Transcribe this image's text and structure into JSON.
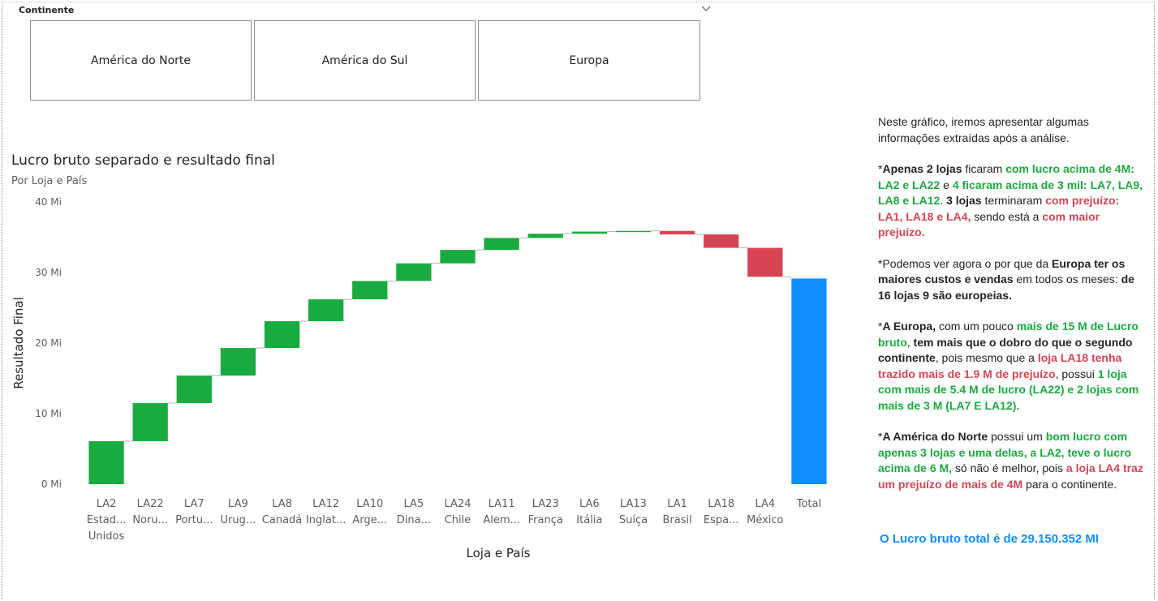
{
  "slicer": {
    "header": "Continente",
    "options": [
      "América do Norte",
      "América do Sul",
      "Europa"
    ]
  },
  "chart": {
    "title": "Lucro bruto separado e resultado final",
    "subtitle": "Por Loja e País"
  },
  "chart_data": {
    "type": "waterfall",
    "title": "Lucro bruto separado e resultado final",
    "subtitle": "Por Loja e País",
    "xlabel": "Loja e País",
    "ylabel": "Resultado Final",
    "ylim": [
      0,
      40
    ],
    "y_unit": "Mi",
    "yticks": [
      "0 Mi",
      "10 Mi",
      "20 Mi",
      "30 Mi",
      "40 Mi"
    ],
    "categories": [
      {
        "store": "LA2",
        "country": "Estad... Unidos",
        "value": 6.1
      },
      {
        "store": "LA22",
        "country": "Noru...",
        "value": 5.4
      },
      {
        "store": "LA7",
        "country": "Portu...",
        "value": 3.9
      },
      {
        "store": "LA9",
        "country": "Urug...",
        "value": 3.9
      },
      {
        "store": "LA8",
        "country": "Canadá",
        "value": 3.8
      },
      {
        "store": "LA12",
        "country": "Inglat...",
        "value": 3.1
      },
      {
        "store": "LA10",
        "country": "Arge...",
        "value": 2.6
      },
      {
        "store": "LA5",
        "country": "Dina...",
        "value": 2.5
      },
      {
        "store": "LA24",
        "country": "Chile",
        "value": 1.9
      },
      {
        "store": "LA11",
        "country": "Alem...",
        "value": 1.7
      },
      {
        "store": "LA23",
        "country": "França",
        "value": 0.6
      },
      {
        "store": "LA6",
        "country": "Itália",
        "value": 0.3
      },
      {
        "store": "LA13",
        "country": "Suíça",
        "value": 0.1
      },
      {
        "store": "LA1",
        "country": "Brasil",
        "value": -0.5
      },
      {
        "store": "LA18",
        "country": "Espa...",
        "value": -1.9
      },
      {
        "store": "LA4",
        "country": "México",
        "value": -4.1
      }
    ],
    "total": {
      "label": "Total",
      "value": 29.15
    },
    "colors": {
      "increase": "#1aab40",
      "decrease": "#d64554",
      "total": "#118dff"
    },
    "grid": false
  },
  "text_panel": {
    "intro": "Neste gráfico, iremos apresentar algumas informações extraídas após a análise.",
    "p1": [
      "*",
      "Apenas 2 lojas",
      " ficaram ",
      "com lucro acima de 4M: LA2 e LA22",
      " e ",
      "4 ficaram acima de 3 mil: LA7, LA9, LA8 e LA12",
      ". ",
      "3 lojas",
      " terminaram ",
      "com prejuízo: LA1, LA18 e LA4,",
      " sendo está a ",
      "com maior prejuízo."
    ],
    "p2": [
      "*Podemos ver agora o por que da ",
      "Europa ter os maiores custos e vendas",
      " em todos os meses: ",
      "de 16 lojas 9 são europeias."
    ],
    "p3": [
      "*",
      "A Europa,",
      " com um pouco ",
      "mais de 15 M de Lucro bruto",
      ", ",
      "tem mais que o dobro do que o segundo continente",
      ", pois mesmo que a ",
      "loja LA18 tenha trazido mais de 1.9 M de prejuízo",
      ", possui ",
      "1 loja com mais de 5.4 M de lucro (LA22) e 2 lojas com mais de 3 M (LA7 E LA12)."
    ],
    "p4": [
      "*",
      "A América do Norte",
      " possui um ",
      "bom lucro com apenas 3 lojas e uma delas, a LA2, teve o lucro acima de 6 M,",
      " só não é melhor, pois ",
      "a loja LA4 traz um prejuízo de mais de 4M",
      " para o continente."
    ],
    "total": "O Lucro bruto total é de 29.150.352 MI"
  }
}
